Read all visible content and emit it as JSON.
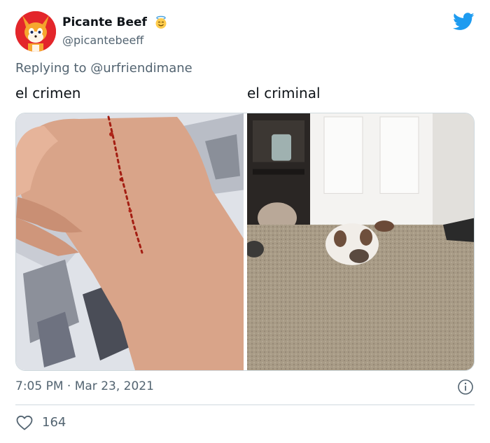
{
  "author": {
    "display_name": "Picante Beef",
    "handle": "@picantebeeff",
    "badge_icon": "halo-smile-emoji-icon",
    "avatar_icon": "fox-cartoon-avatar"
  },
  "reply": {
    "prefix": "Replying to",
    "handle": "@urfriendimane"
  },
  "captions": {
    "left": "el crimen",
    "right": "el criminal"
  },
  "meta": {
    "time": "7:05 PM · Mar 23, 2021"
  },
  "engagement": {
    "likes": "164"
  },
  "icons": {
    "brand": "twitter-bird-icon",
    "info": "info-icon",
    "like": "heart-outline-icon"
  },
  "colors": {
    "brand": "#1d9bf0",
    "muted": "#536471",
    "text": "#0f1419"
  }
}
